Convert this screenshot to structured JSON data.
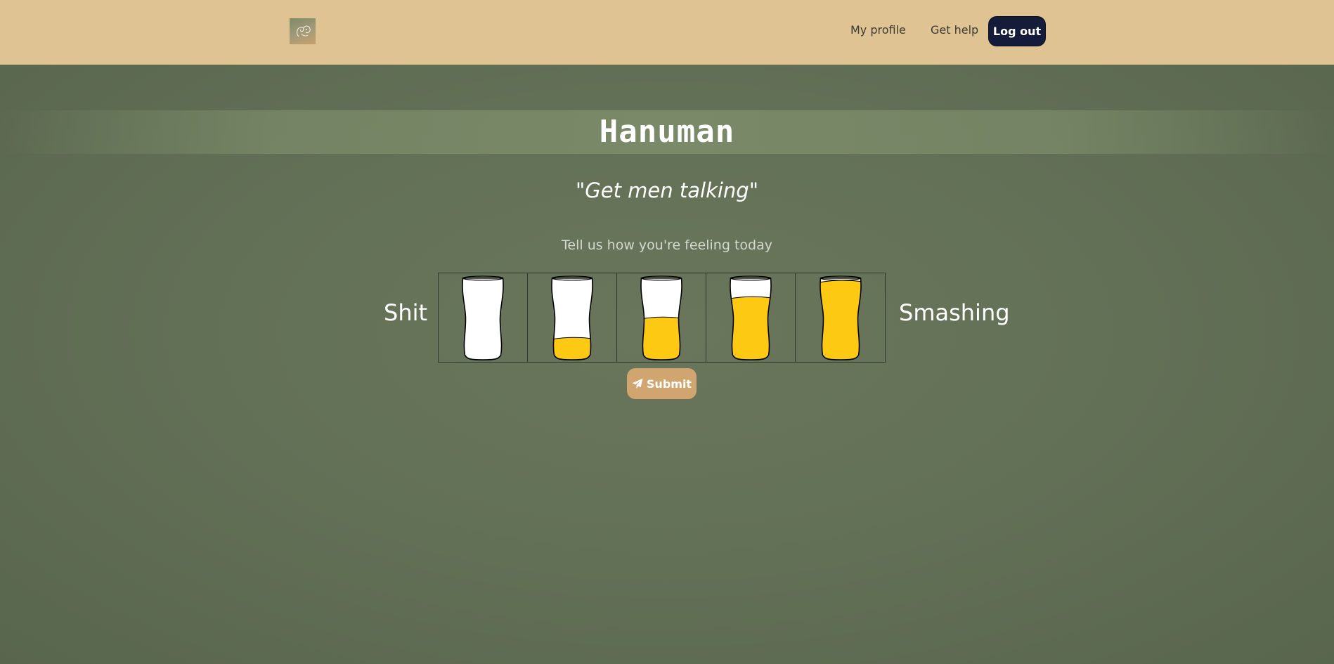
{
  "nav": {
    "logo_icon": "monkey-logo-icon",
    "links": [
      "My profile",
      "Get help"
    ],
    "logout_label": "Log out"
  },
  "hero": {
    "title_part1": "Hanu",
    "title_part2": "man",
    "tagline": "\"Get men talking\""
  },
  "mood": {
    "prompt": "Tell us how you're feeling today",
    "low_label": "Shit",
    "high_label": "Smashing",
    "options": [
      {
        "fill": 0.0
      },
      {
        "fill": 0.25
      },
      {
        "fill": 0.5
      },
      {
        "fill": 0.75
      },
      {
        "fill": 0.95
      }
    ],
    "beer_color": "#fec913",
    "glass_color": "#ffffff"
  },
  "submit": {
    "label": "Submit",
    "icon": "paper-plane-icon"
  },
  "colors": {
    "navbar": "#dfc393",
    "logout_bg": "#141c3a",
    "submit_bg": "#d0a56f",
    "page_bg": "#637157"
  }
}
